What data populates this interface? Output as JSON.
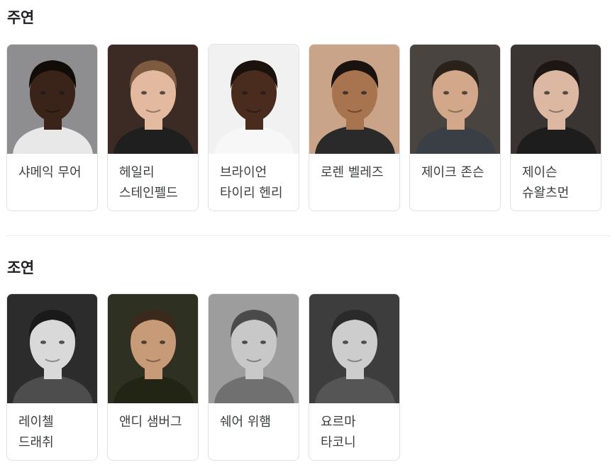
{
  "sections": [
    {
      "title": "주연",
      "cast": [
        {
          "name": "샤메익 무어",
          "bg": "#8e8e90",
          "skin": "#3a2419",
          "hair": "#120c08",
          "shirt": "#e8e8e8"
        },
        {
          "name": "헤일리 스테인펠드",
          "bg": "#3b2b24",
          "skin": "#e3b9a0",
          "hair": "#7d5a40",
          "shirt": "#1f1f1f"
        },
        {
          "name": "브라이언 타이리 헨리",
          "bg": "#f1f1f1",
          "skin": "#4a2c1f",
          "hair": "#1b120d",
          "shirt": "#f7f7f7"
        },
        {
          "name": "로렌 벨레즈",
          "bg": "#caa488",
          "skin": "#a8744f",
          "hair": "#1a120e",
          "shirt": "#2a2a2a"
        },
        {
          "name": "제이크 존슨",
          "bg": "#4a4440",
          "skin": "#d3a88a",
          "hair": "#2a211b",
          "shirt": "#3a3f45"
        },
        {
          "name": "제이슨 슈왈츠먼",
          "bg": "#3a3433",
          "skin": "#dcb7a2",
          "hair": "#1d1613",
          "shirt": "#1d1d1d"
        }
      ]
    },
    {
      "title": "조연",
      "cast": [
        {
          "name": "레이첼 드래취",
          "bg": "#2c2c2c",
          "skin": "#d9d9d9",
          "hair": "#1a1a1a",
          "shirt": "#4d4d4d"
        },
        {
          "name": "앤디 샘버그",
          "bg": "#2e3122",
          "skin": "#c79a78",
          "hair": "#3b2a1c",
          "shirt": "#232514"
        },
        {
          "name": "쉐어 위햄",
          "bg": "#9d9d9d",
          "skin": "#c8c8c8",
          "hair": "#4a4a4a",
          "shirt": "#707070"
        },
        {
          "name": "요르마 타코니",
          "bg": "#3d3d3d",
          "skin": "#cdcdcd",
          "hair": "#2a2a2a",
          "shirt": "#555555"
        }
      ]
    }
  ]
}
